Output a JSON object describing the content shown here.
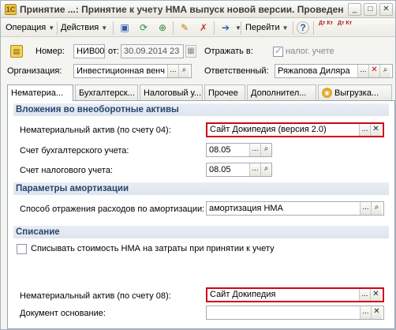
{
  "window": {
    "title": "Принятие ...: Принятие к учету НМА выпуск новой версии. Проведен",
    "app_icon_glyph": "1С"
  },
  "toolbar": {
    "operation_label": "Операция",
    "actions_label": "Действия",
    "goto_label": "Перейти",
    "help_glyph": "?",
    "dt_kt_label": "Дт Кт",
    "dt_kt_n_label": "Дт Кт"
  },
  "header": {
    "number_label": "Номер:",
    "number_value": "НИВ00",
    "from_label": "от:",
    "date_value": "30.09.2014 23",
    "reflect_label": "Отражать в:",
    "tax_accounting_label": "налог. учете",
    "organization_label": "Организация:",
    "organization_value": "Инвестиционная венч",
    "responsible_label": "Ответственный:",
    "responsible_value": "Ряжапова Диляра"
  },
  "tabs": [
    {
      "label": "Нематериа..."
    },
    {
      "label": "Бухгалтерск..."
    },
    {
      "label": "Налоговый у..."
    },
    {
      "label": "Прочее"
    },
    {
      "label": "Дополнител..."
    },
    {
      "label": "Выгрузка..."
    }
  ],
  "sections": {
    "noncurrent": "Вложения во внеоборотные активы",
    "amortization": "Параметры амортизации",
    "writeoff": "Списание"
  },
  "fields": {
    "intangible_04_label": "Нематериальный актив (по счету 04):",
    "intangible_04_value": "Сайт Докипедия (версия 2.0)",
    "accounting_account_label": "Счет бухгалтерского учета:",
    "accounting_account_value": "08.05",
    "tax_account_label": "Счет налогового учета:",
    "tax_account_value": "08.05",
    "amortization_method_label": "Способ отражения расходов по амортизации:",
    "amortization_method_value": "амортизация НМА",
    "writeoff_checkbox_label": "Списывать стоимость НМА на затраты при принятии к учету",
    "intangible_08_label": "Нематериальный актив (по счету 08):",
    "intangible_08_value": "Сайт Докипедия",
    "base_document_label": "Документ основание:",
    "base_document_value": ""
  },
  "accent_colors": {
    "highlight_border": "#d0021b",
    "section_text": "#27466e"
  }
}
